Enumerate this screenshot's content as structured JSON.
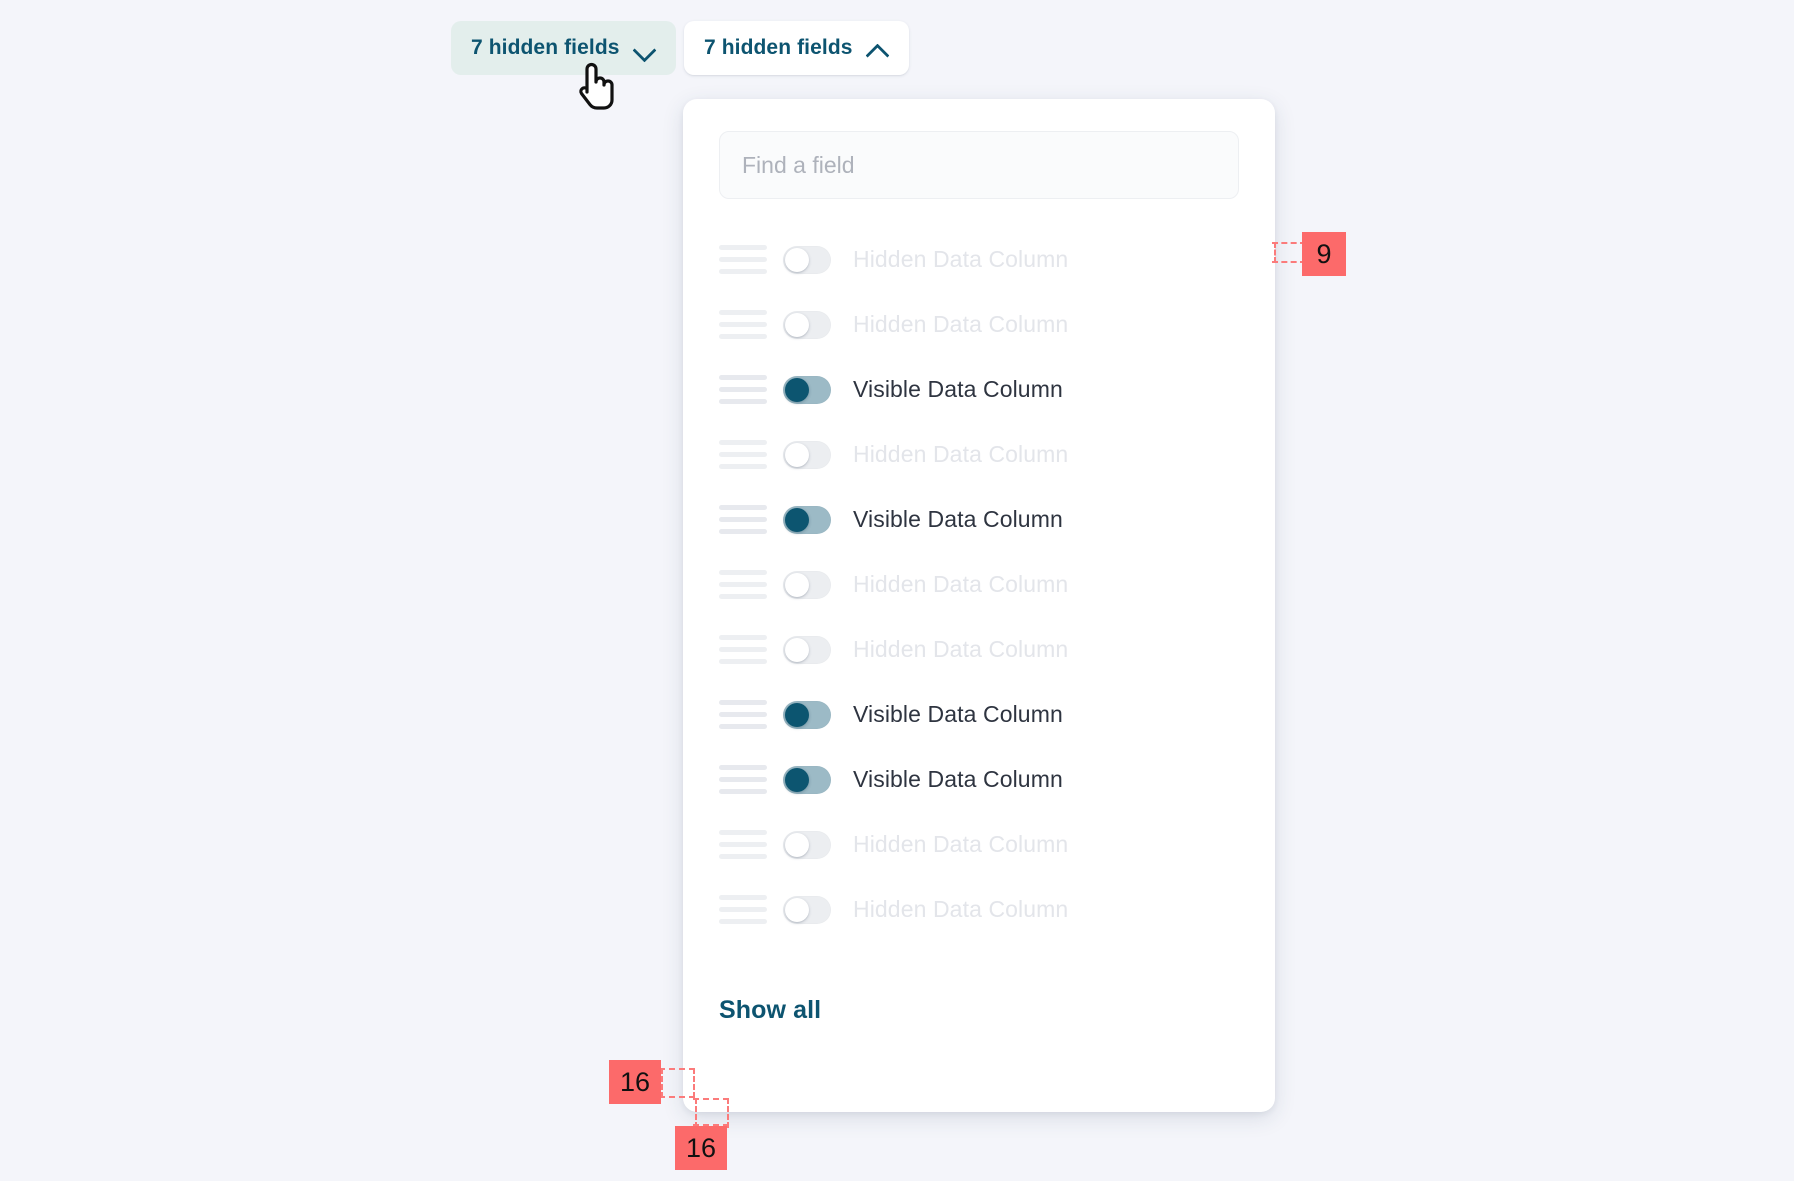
{
  "page": {
    "background_color": "#f4f5fa",
    "accent_color": "#0d5470",
    "toggle_on_track_color": "#9cbac6",
    "toggle_on_knob_color": "#0c5570",
    "annotation_color": "#fc6a6a"
  },
  "triggers": [
    {
      "label": "7 hidden fields",
      "state": "hover",
      "chevron": "chevron-down-icon"
    },
    {
      "label": "7 hidden fields",
      "state": "open",
      "chevron": "chevron-up-icon"
    }
  ],
  "panel": {
    "search": {
      "placeholder": "Find a field",
      "value": ""
    },
    "fields": [
      {
        "label": "Hidden Data Column",
        "visible": false
      },
      {
        "label": "Hidden Data Column",
        "visible": false
      },
      {
        "label": "Visible Data Column",
        "visible": true
      },
      {
        "label": "Hidden Data Column",
        "visible": false
      },
      {
        "label": "Visible Data Column",
        "visible": true
      },
      {
        "label": "Hidden Data Column",
        "visible": false
      },
      {
        "label": "Hidden Data Column",
        "visible": false
      },
      {
        "label": "Visible Data Column",
        "visible": true
      },
      {
        "label": "Visible Data Column",
        "visible": true
      },
      {
        "label": "Hidden Data Column",
        "visible": false
      },
      {
        "label": "Hidden Data Column",
        "visible": false
      }
    ],
    "show_all_label": "Show all"
  },
  "annotations": [
    {
      "id": "spacing-right",
      "value": "9"
    },
    {
      "id": "spacing-bottom-a",
      "value": "16"
    },
    {
      "id": "spacing-bottom-b",
      "value": "16"
    }
  ]
}
